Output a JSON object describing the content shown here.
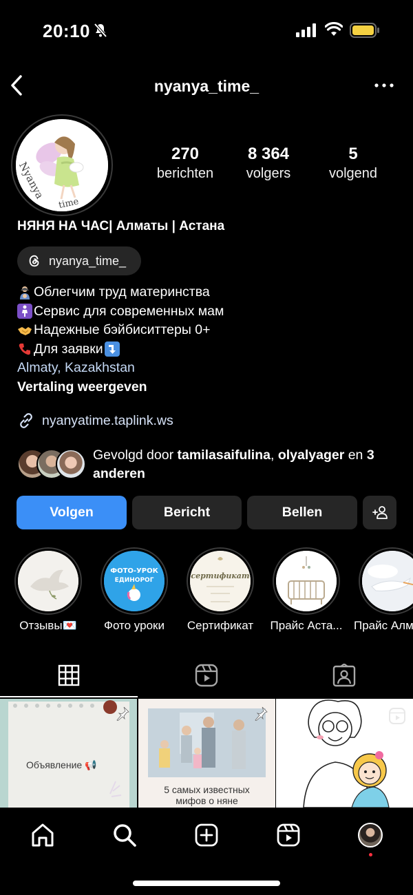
{
  "status_bar": {
    "time": "20:10"
  },
  "header": {
    "username": "nyanya_time_"
  },
  "profile": {
    "stats": [
      {
        "value": "270",
        "label": "berichten"
      },
      {
        "value": "8 364",
        "label": "volgers"
      },
      {
        "value": "5",
        "label": "volgend"
      }
    ],
    "display_name": "НЯНЯ НА ЧАС| Алматы | Астана",
    "threads_handle": "nyanya_time_",
    "bio_lines": [
      "Облегчим труд материнства",
      "Сервис для современных мам",
      "Надежные бэйбиситтеры 0+",
      "Для заявки"
    ],
    "location": "Almaty, Kazakhstan",
    "translate_label": "Vertaling weergeven",
    "link": "nyanyatime.taplink.ws",
    "avatar_text": "Nyanya time",
    "followed_by": {
      "prefix": "Gevolgd door ",
      "user1": "tamilasaifulina",
      "sep": ", ",
      "user2": "olyalyager",
      "mid": " en ",
      "others": "3 anderen"
    }
  },
  "actions": {
    "follow": "Volgen",
    "message": "Bericht",
    "call": "Bellen"
  },
  "highlights": [
    {
      "label": "Отзывы💌"
    },
    {
      "label": "Фото уроки",
      "cover_text_1": "ФОТО-УРОК",
      "cover_text_2": "ЕДИНОРОГ"
    },
    {
      "label": "Сертификат",
      "cover_text": "сертификат"
    },
    {
      "label": "Прайс Аста..."
    },
    {
      "label": "Прайс Алм"
    }
  ],
  "posts": [
    {
      "caption": "Объявление 📢"
    },
    {
      "caption_1": "5 самых известных",
      "caption_2": "мифов о няне"
    },
    {
      "caption": ""
    }
  ],
  "colors": {
    "background": "#000000",
    "primary_button": "#3b8ff7",
    "secondary_button": "#262626",
    "battery": "#f5d142",
    "notification_dot": "#ff3040"
  }
}
